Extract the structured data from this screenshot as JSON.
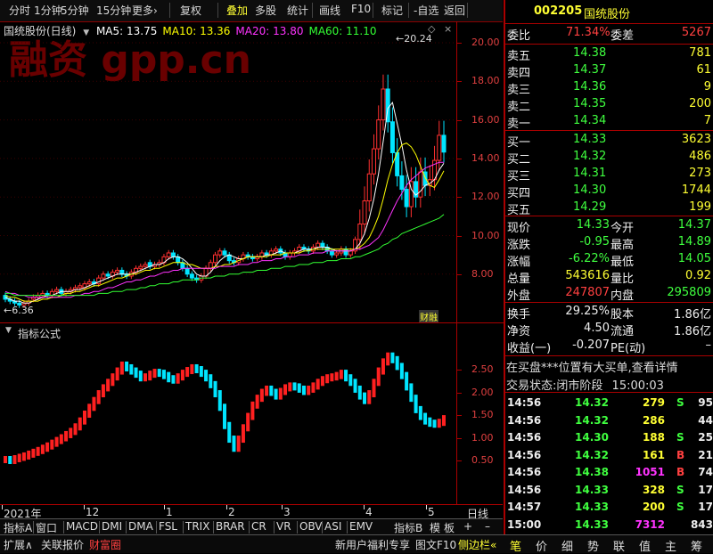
{
  "toolbar": {
    "items": [
      "分时",
      "1分钟",
      "5分钟",
      "15分钟",
      "更多›",
      "复权",
      "叠加",
      "多股",
      "统计",
      "画线",
      "F10",
      "标记",
      "-自选",
      "返回"
    ],
    "active": "叠加"
  },
  "chart": {
    "title": "国统股份(日线)",
    "ma_labels": [
      {
        "text": "MA5: 13.75",
        "color": "#ffffff"
      },
      {
        "text": "MA10: 13.36",
        "color": "#ffff00"
      },
      {
        "text": "MA20: 13.80",
        "color": "#ff33ff"
      },
      {
        "text": "MA60: 11.10",
        "color": "#33ff33"
      }
    ],
    "high_label": "20.24",
    "low_label": "6.36",
    "watermark": "融资 gpp.cn",
    "badge": "财融",
    "price_ticks": [
      "20.00",
      "18.00",
      "16.00",
      "14.00",
      "12.00",
      "10.00",
      "8.00"
    ],
    "candles": [
      [
        6.9,
        6.7
      ],
      [
        6.7,
        6.6
      ],
      [
        6.6,
        6.5
      ],
      [
        6.5,
        6.4
      ],
      [
        6.4,
        6.5
      ],
      [
        6.5,
        6.6
      ],
      [
        6.7,
        6.8
      ],
      [
        6.8,
        6.9
      ],
      [
        6.9,
        7.0
      ],
      [
        7.0,
        6.9
      ],
      [
        6.9,
        7.1
      ],
      [
        7.1,
        7.2
      ],
      [
        7.2,
        7.0
      ],
      [
        7.0,
        7.1
      ],
      [
        7.1,
        7.2
      ],
      [
        7.2,
        7.3
      ],
      [
        7.3,
        7.4
      ],
      [
        7.3,
        7.5
      ],
      [
        7.5,
        7.6
      ],
      [
        7.6,
        7.5
      ],
      [
        7.5,
        7.8
      ],
      [
        7.8,
        8.0
      ],
      [
        8.0,
        7.9
      ],
      [
        7.9,
        8.1
      ],
      [
        8.1,
        8.2
      ],
      [
        8.2,
        8.0
      ],
      [
        8.0,
        7.9
      ],
      [
        7.9,
        8.1
      ],
      [
        8.1,
        8.3
      ],
      [
        8.3,
        8.4
      ],
      [
        8.4,
        8.5
      ],
      [
        8.6,
        8.4
      ],
      [
        8.4,
        8.5
      ],
      [
        8.5,
        8.6
      ],
      [
        8.6,
        8.9
      ],
      [
        8.9,
        9.1
      ],
      [
        9.1,
        8.9
      ],
      [
        8.9,
        8.6
      ],
      [
        8.6,
        8.3
      ],
      [
        8.3,
        8.0
      ],
      [
        8.0,
        7.8
      ],
      [
        7.8,
        7.7
      ],
      [
        7.7,
        7.9
      ],
      [
        7.9,
        8.3
      ],
      [
        8.3,
        8.6
      ],
      [
        8.6,
        9.0
      ],
      [
        9.0,
        9.2
      ],
      [
        9.2,
        9.0
      ],
      [
        9.0,
        8.7
      ],
      [
        8.7,
        8.6
      ],
      [
        8.6,
        8.8
      ],
      [
        8.8,
        9.0
      ],
      [
        9.0,
        8.9
      ],
      [
        8.9,
        8.8
      ],
      [
        8.8,
        8.9
      ],
      [
        8.9,
        9.1
      ],
      [
        9.1,
        9.0
      ],
      [
        9.0,
        9.2
      ],
      [
        9.2,
        9.3
      ],
      [
        9.3,
        9.1
      ],
      [
        9.1,
        8.9
      ],
      [
        8.9,
        9.1
      ],
      [
        9.1,
        9.2
      ],
      [
        9.2,
        9.4
      ],
      [
        9.4,
        9.3
      ],
      [
        9.3,
        9.2
      ],
      [
        9.2,
        9.4
      ],
      [
        9.4,
        9.6
      ],
      [
        9.6,
        9.4
      ],
      [
        9.4,
        9.2
      ],
      [
        9.2,
        9.0
      ],
      [
        9.0,
        9.1
      ],
      [
        9.1,
        9.3
      ],
      [
        9.3,
        9.0
      ],
      [
        9.0,
        9.2
      ],
      [
        9.2,
        9.8
      ],
      [
        9.8,
        10.6
      ],
      [
        10.6,
        11.8
      ],
      [
        11.8,
        13.2
      ],
      [
        13.2,
        14.5
      ],
      [
        14.5,
        16.0
      ],
      [
        16.0,
        17.6
      ],
      [
        17.6,
        15.9
      ],
      [
        15.9,
        14.3
      ],
      [
        14.3,
        13.1
      ],
      [
        13.1,
        12.4
      ],
      [
        12.4,
        11.5
      ],
      [
        11.5,
        12.8
      ],
      [
        12.8,
        12.0
      ],
      [
        12.0,
        13.3
      ],
      [
        13.3,
        12.6
      ],
      [
        12.6,
        12.9
      ],
      [
        12.9,
        13.9
      ],
      [
        13.9,
        15.2
      ],
      [
        15.2,
        14.33
      ]
    ],
    "ma_series": [
      {
        "name": "MA5",
        "color": "#ffffff",
        "values": [
          6.8,
          6.7,
          6.6,
          6.6,
          6.5,
          6.5,
          6.6,
          6.7,
          6.8,
          6.9,
          6.9,
          7.0,
          7.1,
          7.1,
          7.1,
          7.2,
          7.2,
          7.3,
          7.4,
          7.5,
          7.6,
          7.7,
          7.8,
          7.9,
          8.0,
          8.0,
          8.0,
          8.0,
          8.1,
          8.2,
          8.3,
          8.4,
          8.5,
          8.5,
          8.6,
          8.8,
          8.9,
          8.9,
          8.8,
          8.6,
          8.3,
          8.0,
          7.9,
          7.9,
          8.1,
          8.4,
          8.7,
          8.9,
          9.0,
          8.9,
          8.8,
          8.8,
          8.9,
          8.9,
          8.9,
          8.9,
          9.0,
          9.0,
          9.1,
          9.2,
          9.1,
          9.1,
          9.1,
          9.2,
          9.3,
          9.3,
          9.3,
          9.4,
          9.4,
          9.4,
          9.3,
          9.2,
          9.2,
          9.2,
          9.2,
          9.3,
          9.6,
          10.1,
          10.9,
          11.9,
          13.2,
          14.9,
          16.6,
          16.9,
          15.8,
          14.7,
          13.4,
          12.4,
          12.1,
          12.3,
          12.6,
          12.7,
          12.9,
          13.4,
          13.75
        ]
      },
      {
        "name": "MA10",
        "color": "#ffff00",
        "values": [
          6.9,
          6.8,
          6.8,
          6.7,
          6.6,
          6.6,
          6.6,
          6.6,
          6.7,
          6.7,
          6.8,
          6.8,
          6.9,
          7.0,
          7.0,
          7.1,
          7.1,
          7.2,
          7.3,
          7.4,
          7.4,
          7.5,
          7.6,
          7.7,
          7.8,
          7.8,
          7.9,
          8.0,
          8.0,
          8.1,
          8.2,
          8.2,
          8.3,
          8.3,
          8.4,
          8.5,
          8.6,
          8.6,
          8.6,
          8.5,
          8.5,
          8.4,
          8.3,
          8.3,
          8.3,
          8.4,
          8.4,
          8.5,
          8.5,
          8.6,
          8.7,
          8.8,
          8.9,
          8.9,
          8.9,
          8.9,
          8.9,
          9.0,
          9.0,
          9.0,
          9.1,
          9.1,
          9.1,
          9.1,
          9.2,
          9.2,
          9.3,
          9.3,
          9.3,
          9.3,
          9.3,
          9.3,
          9.3,
          9.3,
          9.3,
          9.3,
          9.4,
          9.6,
          9.9,
          10.4,
          11.0,
          11.9,
          12.9,
          13.7,
          14.3,
          14.7,
          14.8,
          14.6,
          14.2,
          13.6,
          13.0,
          12.6,
          12.5,
          12.9,
          13.36
        ]
      },
      {
        "name": "MA20",
        "color": "#ff33ff",
        "values": [
          7.1,
          7.0,
          7.0,
          6.9,
          6.9,
          6.8,
          6.8,
          6.8,
          6.8,
          6.8,
          6.8,
          6.8,
          6.8,
          6.8,
          6.8,
          6.9,
          6.9,
          7.0,
          7.0,
          7.1,
          7.1,
          7.2,
          7.3,
          7.3,
          7.4,
          7.5,
          7.6,
          7.6,
          7.7,
          7.7,
          7.8,
          7.9,
          7.9,
          8.0,
          8.1,
          8.1,
          8.2,
          8.2,
          8.3,
          8.3,
          8.3,
          8.3,
          8.3,
          8.3,
          8.3,
          8.3,
          8.4,
          8.4,
          8.4,
          8.4,
          8.5,
          8.5,
          8.5,
          8.6,
          8.6,
          8.7,
          8.7,
          8.7,
          8.8,
          8.8,
          8.9,
          8.9,
          8.9,
          9.0,
          9.0,
          9.0,
          9.1,
          9.1,
          9.1,
          9.2,
          9.2,
          9.2,
          9.2,
          9.2,
          9.2,
          9.3,
          9.3,
          9.4,
          9.5,
          9.7,
          9.9,
          10.3,
          10.8,
          11.3,
          11.8,
          12.2,
          12.6,
          12.9,
          13.1,
          13.3,
          13.5,
          13.6,
          13.7,
          13.8,
          13.8
        ]
      },
      {
        "name": "MA60",
        "color": "#33ff33",
        "values": [
          7.0,
          7.0,
          6.9,
          6.9,
          6.9,
          6.9,
          6.9,
          6.9,
          6.9,
          6.9,
          6.9,
          6.9,
          6.9,
          6.9,
          6.9,
          6.9,
          6.9,
          6.9,
          6.9,
          6.9,
          7.0,
          7.0,
          7.0,
          7.1,
          7.1,
          7.1,
          7.2,
          7.2,
          7.2,
          7.3,
          7.3,
          7.4,
          7.4,
          7.5,
          7.5,
          7.5,
          7.6,
          7.6,
          7.7,
          7.7,
          7.7,
          7.7,
          7.8,
          7.8,
          7.8,
          7.9,
          7.9,
          7.9,
          8.0,
          8.0,
          8.0,
          8.1,
          8.1,
          8.1,
          8.2,
          8.2,
          8.2,
          8.3,
          8.3,
          8.3,
          8.4,
          8.4,
          8.4,
          8.5,
          8.5,
          8.5,
          8.6,
          8.6,
          8.6,
          8.7,
          8.7,
          8.7,
          8.8,
          8.8,
          8.8,
          8.9,
          8.9,
          9.0,
          9.1,
          9.2,
          9.3,
          9.5,
          9.6,
          9.8,
          9.9,
          10.1,
          10.2,
          10.3,
          10.4,
          10.5,
          10.6,
          10.7,
          10.8,
          10.9,
          11.1
        ]
      }
    ]
  },
  "indicator": {
    "title": "指标公式",
    "ticks": [
      "2.50",
      "2.00",
      "1.50",
      "1.00",
      "0.50"
    ],
    "values": [
      0.5,
      0.48,
      0.52,
      0.55,
      0.58,
      0.62,
      0.66,
      0.7,
      0.75,
      0.8,
      0.86,
      0.92,
      0.98,
      1.05,
      1.12,
      1.22,
      1.35,
      1.5,
      1.65,
      1.8,
      1.95,
      2.08,
      2.2,
      2.32,
      2.45,
      2.58,
      2.52,
      2.45,
      2.38,
      2.3,
      2.32,
      2.38,
      2.42,
      2.4,
      2.35,
      2.28,
      2.25,
      2.32,
      2.4,
      2.46,
      2.52,
      2.48,
      2.4,
      2.3,
      2.15,
      1.95,
      1.65,
      1.25,
      0.95,
      0.75,
      0.95,
      1.2,
      1.45,
      1.7,
      1.85,
      1.98,
      2.05,
      1.98,
      1.9,
      2.0,
      2.08,
      2.12,
      2.1,
      2.05,
      2.0,
      2.05,
      2.12,
      2.2,
      2.26,
      2.3,
      2.32,
      2.35,
      2.4,
      2.3,
      2.2,
      2.05,
      1.9,
      1.8,
      1.95,
      2.2,
      2.45,
      2.65,
      2.78,
      2.7,
      2.55,
      2.35,
      2.1,
      1.85,
      1.6,
      1.45,
      1.35,
      1.3,
      1.28,
      1.32,
      1.4
    ]
  },
  "date_axis": {
    "labels": [
      "2021年",
      "12",
      "1",
      "2",
      "3",
      "4",
      "5"
    ],
    "period": "日线"
  },
  "tabs": [
    "指标A",
    "窗口",
    "MACD",
    "DMI",
    "DMA",
    "FSL",
    "TRIX",
    "BRAR",
    "CR",
    "VR",
    "OBV",
    "ASI",
    "EMV",
    "指标B",
    "模",
    "板",
    "+",
    "–"
  ],
  "bottom_left": [
    "扩展∧",
    "关联报价",
    "财富圈"
  ],
  "bottom_mid": [
    "新用户福利专享",
    "图文F10",
    "侧边栏«"
  ],
  "bottom_right": [
    "笔",
    "价",
    "细",
    "势",
    "联",
    "值",
    "主",
    "筹"
  ],
  "stock": {
    "code": "002205",
    "name": "国统股份"
  },
  "order_summary": {
    "wb_label": "委比",
    "wb_value": "71.34%",
    "wc_label": "委差",
    "wc_value": "5267"
  },
  "asks": [
    {
      "label": "卖五",
      "price": "14.38",
      "vol": "781"
    },
    {
      "label": "卖四",
      "price": "14.37",
      "vol": "61"
    },
    {
      "label": "卖三",
      "price": "14.36",
      "vol": "9"
    },
    {
      "label": "卖二",
      "price": "14.35",
      "vol": "200"
    },
    {
      "label": "卖一",
      "price": "14.34",
      "vol": "7"
    }
  ],
  "bids": [
    {
      "label": "买一",
      "price": "14.33",
      "vol": "3623"
    },
    {
      "label": "买二",
      "price": "14.32",
      "vol": "486"
    },
    {
      "label": "买三",
      "price": "14.31",
      "vol": "273"
    },
    {
      "label": "买四",
      "price": "14.30",
      "vol": "1744"
    },
    {
      "label": "买五",
      "price": "14.29",
      "vol": "199"
    }
  ],
  "stats": [
    {
      "l1": "现价",
      "v1": "14.33",
      "c1": "down",
      "l2": "今开",
      "v2": "14.37",
      "c2": "down"
    },
    {
      "l1": "涨跌",
      "v1": "-0.95",
      "c1": "down",
      "l2": "最高",
      "v2": "14.89",
      "c2": "down"
    },
    {
      "l1": "涨幅",
      "v1": "-6.22%",
      "c1": "down",
      "l2": "最低",
      "v2": "14.05",
      "c2": "down"
    },
    {
      "l1": "总量",
      "v1": "543616",
      "c1": "yel",
      "l2": "量比",
      "v2": "0.92",
      "c2": "yel"
    },
    {
      "l1": "外盘",
      "v1": "247807",
      "c1": "up",
      "l2": "内盘",
      "v2": "295809",
      "c2": "down"
    }
  ],
  "fund": [
    {
      "l1": "换手",
      "v1": "29.25%",
      "l2": "股本",
      "v2": "1.86亿"
    },
    {
      "l1": "净资",
      "v1": "4.50",
      "l2": "流通",
      "v2": "1.86亿"
    },
    {
      "l1": "收益(一)",
      "v1": "-0.207",
      "l2": "PE(动)",
      "v2": "–"
    }
  ],
  "notice": "在买盘***位置有大买单,查看详情",
  "trade_state": {
    "label": "交易状态:",
    "value": "闭市阶段",
    "time": "15:00:03"
  },
  "trades": [
    {
      "time": "14:56",
      "price": "14.32",
      "vol": "279",
      "side": "S",
      "n": "95",
      "vc": "yel"
    },
    {
      "time": "14:56",
      "price": "14.32",
      "vol": "286",
      "side": "",
      "n": "44",
      "vc": "yel"
    },
    {
      "time": "14:56",
      "price": "14.30",
      "vol": "188",
      "side": "S",
      "n": "25",
      "vc": "yel"
    },
    {
      "time": "14:56",
      "price": "14.32",
      "vol": "161",
      "side": "B",
      "n": "21",
      "vc": "yel"
    },
    {
      "time": "14:56",
      "price": "14.38",
      "vol": "1051",
      "side": "B",
      "n": "74",
      "vc": "mag"
    },
    {
      "time": "14:56",
      "price": "14.33",
      "vol": "328",
      "side": "S",
      "n": "17",
      "vc": "yel"
    },
    {
      "time": "14:57",
      "price": "14.33",
      "vol": "200",
      "side": "S",
      "n": "17",
      "vc": "yel"
    },
    {
      "time": "15:00",
      "price": "14.33",
      "vol": "7312",
      "side": "",
      "n": "843",
      "vc": "mag"
    }
  ]
}
